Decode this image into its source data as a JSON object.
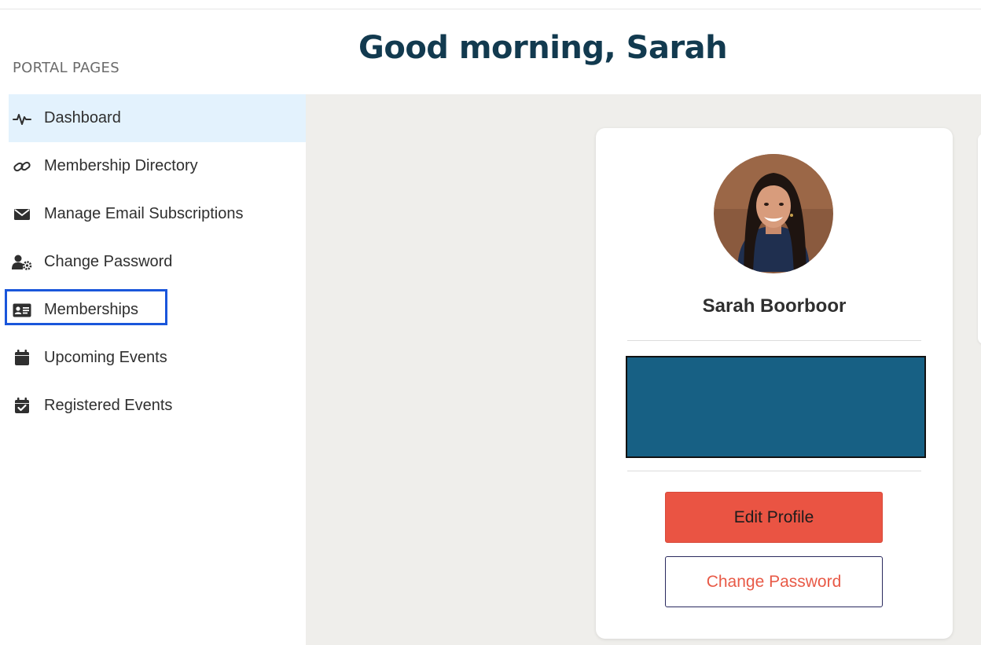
{
  "sidebar": {
    "section_label": "PORTAL PAGES",
    "items": [
      {
        "label": "Dashboard",
        "icon": "pulse-icon",
        "active": true
      },
      {
        "label": "Membership Directory",
        "icon": "link-icon"
      },
      {
        "label": "Manage Email Subscriptions",
        "icon": "envelope-icon"
      },
      {
        "label": "Change Password",
        "icon": "user-gear-icon"
      },
      {
        "label": "Memberships",
        "icon": "id-card-icon",
        "highlighted": true
      },
      {
        "label": "Upcoming Events",
        "icon": "calendar-icon"
      },
      {
        "label": "Registered Events",
        "icon": "calendar-check-icon"
      }
    ]
  },
  "header": {
    "greeting": "Good morning, Sarah"
  },
  "profile": {
    "name": "Sarah Boorboor",
    "edit_label": "Edit Profile",
    "change_password_label": "Change Password"
  },
  "colors": {
    "title": "#123a4f",
    "active_bg": "#e3f2fd",
    "highlight_border": "#1a56db",
    "info_block": "#176084",
    "primary_button": "#ea5443",
    "secondary_text": "#e85a47",
    "main_bg": "#efeeeb"
  }
}
